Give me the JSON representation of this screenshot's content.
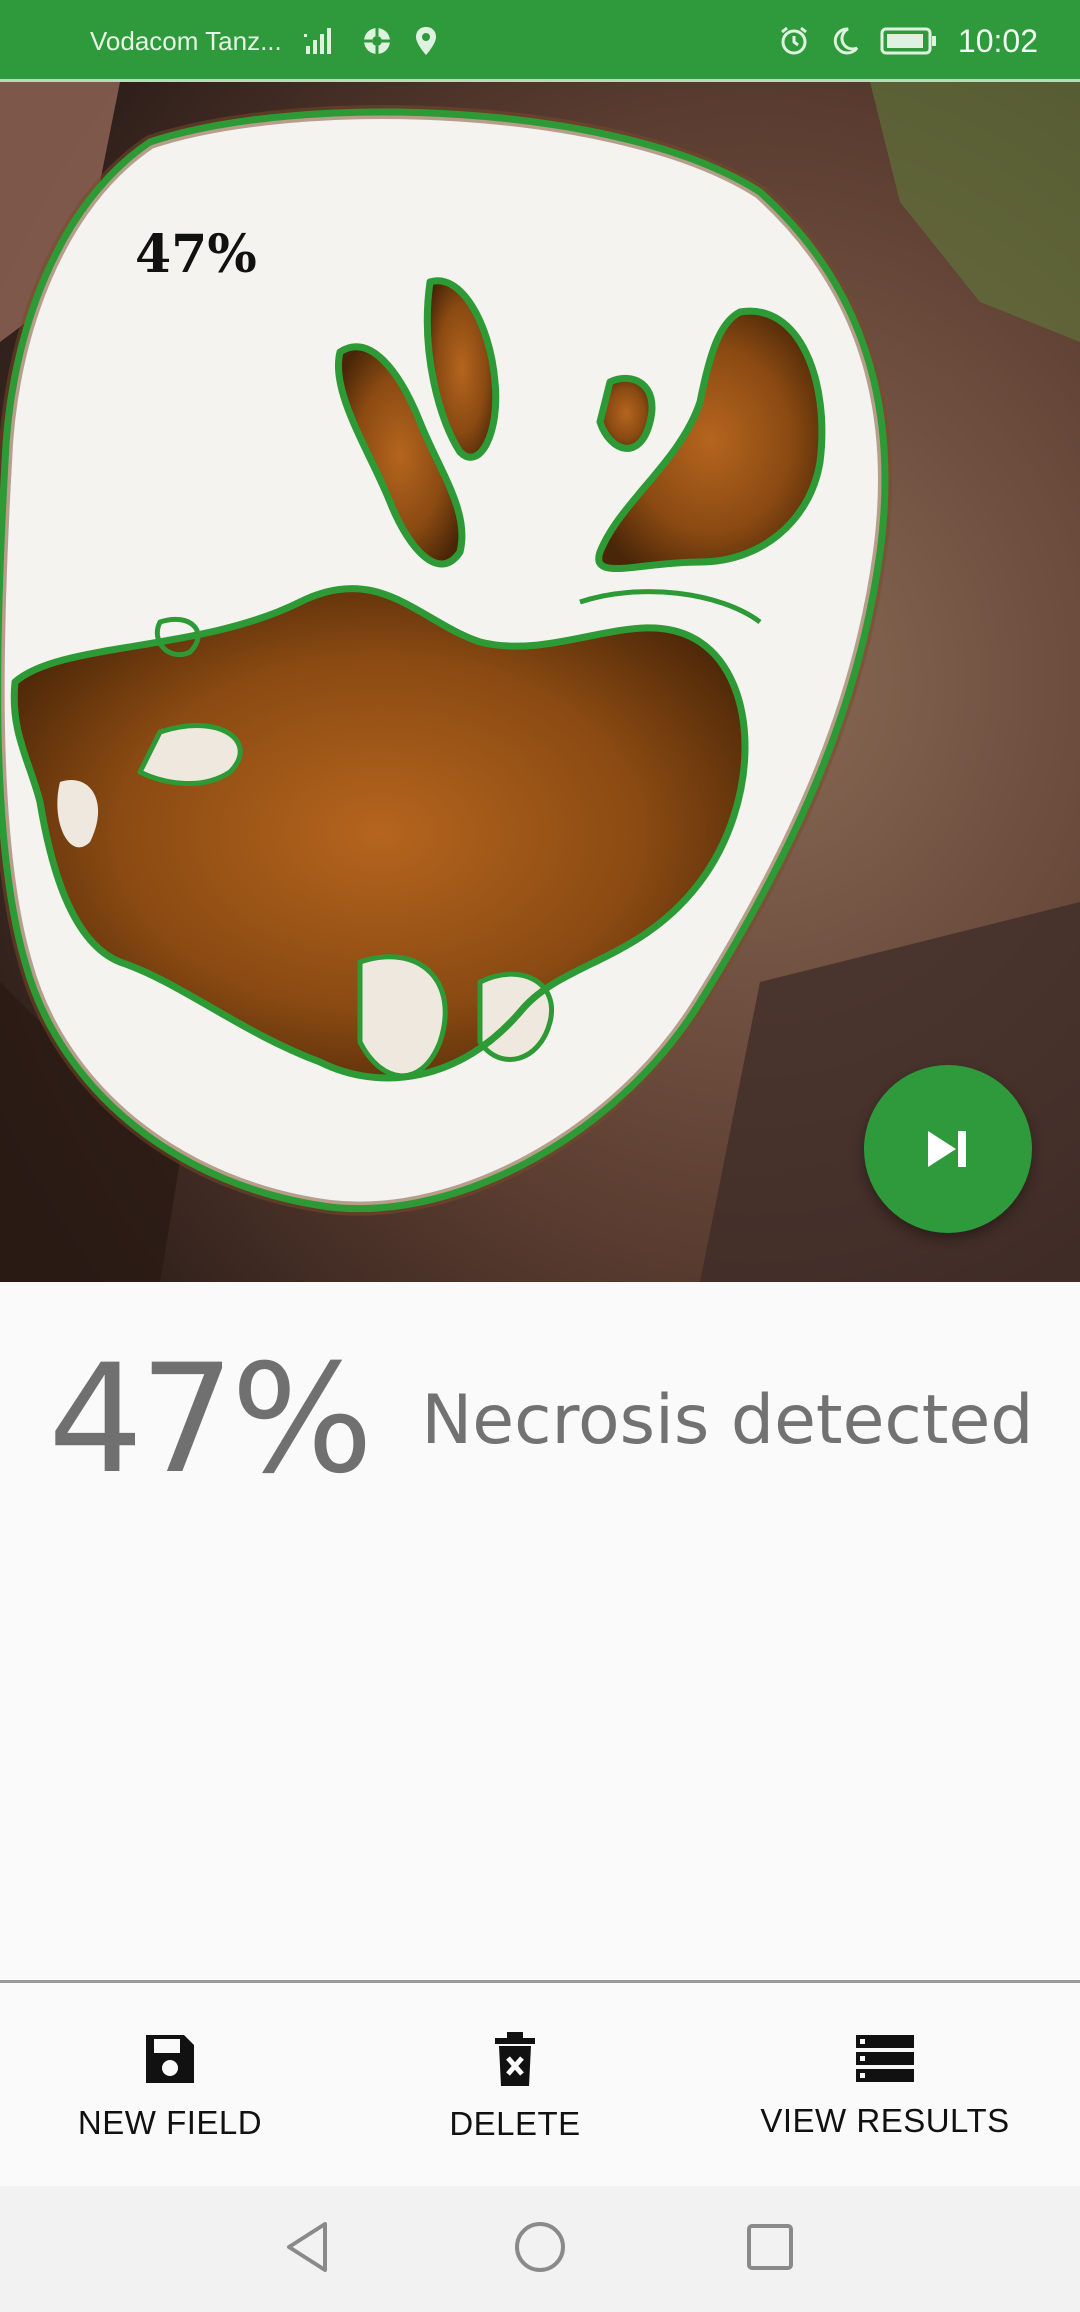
{
  "status_bar": {
    "carrier": "Vodacom Tanz...",
    "time": "10:02",
    "icons": [
      "signal-icon",
      "data-icon",
      "location-icon",
      "alarm-icon",
      "moon-icon",
      "battery-icon"
    ],
    "background": "#2f9a3b"
  },
  "photo": {
    "overlay_text": "47%",
    "contour_color": "#2e9a36"
  },
  "result": {
    "percentage": "47%",
    "label": "Necrosis detected"
  },
  "fab": {
    "icon": "skip-next-icon"
  },
  "bottom_nav": {
    "new_field": "NEW FIELD",
    "delete": "DELETE",
    "view_results": "VIEW RESULTS"
  },
  "system_nav": {
    "back": "back-icon",
    "home": "home-icon",
    "recents": "recents-icon"
  }
}
